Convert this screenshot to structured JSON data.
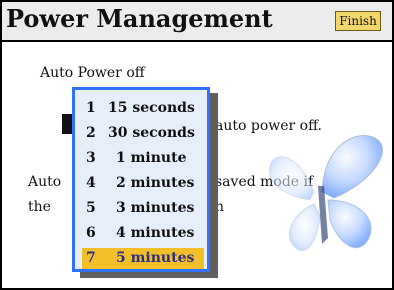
{
  "header": {
    "title": "Power Management",
    "finish_label": "Finish"
  },
  "labels": {
    "auto_power_off": "Auto Power off",
    "auto_power_off_tail": "auto power off.",
    "auto_left": "Auto",
    "saved_mode_tail": "saved mode if",
    "the_left": "the",
    "n_tail": "n"
  },
  "dropdown": {
    "items": [
      {
        "num": "1",
        "label": "15 seconds"
      },
      {
        "num": "2",
        "label": "30 seconds"
      },
      {
        "num": "3",
        "label": "1 minute"
      },
      {
        "num": "4",
        "label": "2 minutes"
      },
      {
        "num": "5",
        "label": "3 minutes"
      },
      {
        "num": "6",
        "label": "4 minutes"
      },
      {
        "num": "7",
        "label": "5 minutes"
      }
    ],
    "selected_index": 6
  },
  "colors": {
    "popup_border": "#2f72ff",
    "popup_bg": "#e6eef9",
    "selected_bg": "#f2bf2a",
    "finish_bg": "#f3d76a"
  },
  "icons": {
    "butterfly": "butterfly-icon"
  }
}
